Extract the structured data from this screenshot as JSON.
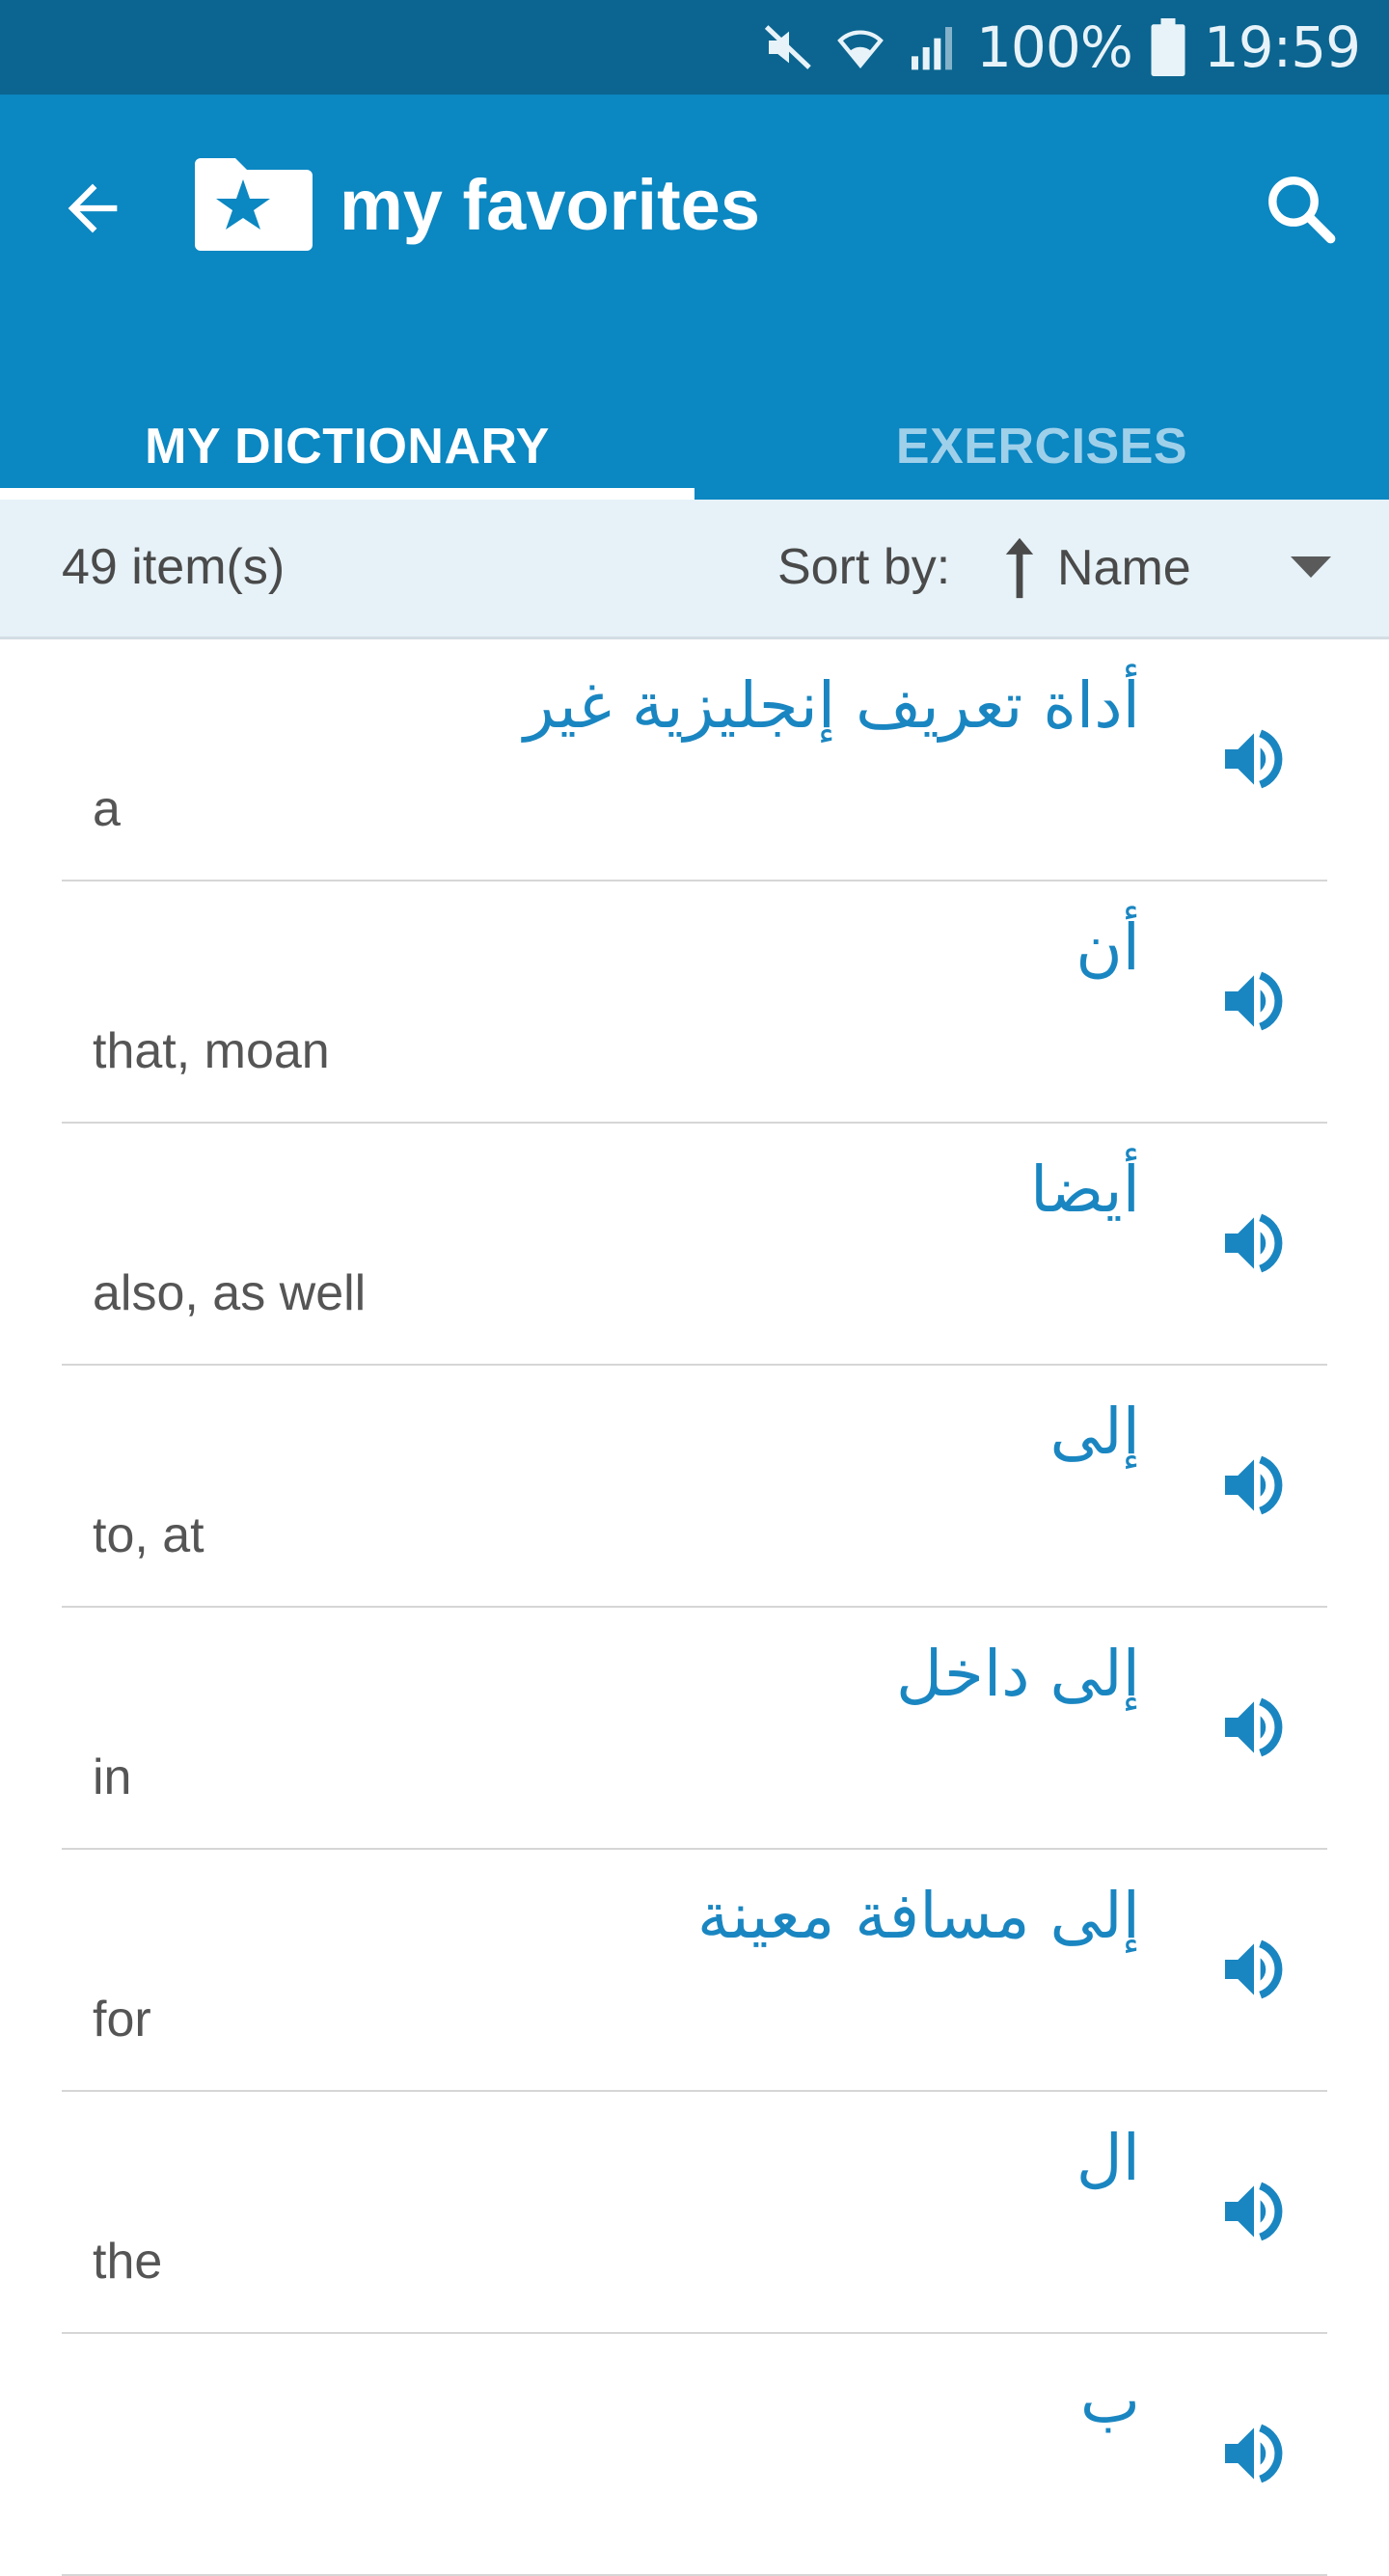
{
  "status_bar": {
    "battery": "100%",
    "time": "19:59",
    "icons": [
      "mute-icon",
      "wifi-icon",
      "signal-icon",
      "battery-icon"
    ]
  },
  "app_bar": {
    "title": "my favorites",
    "icons": [
      "back-arrow-icon",
      "star-folder-icon",
      "search-icon"
    ]
  },
  "tabs": [
    {
      "label": "MY DICTIONARY",
      "active": true
    },
    {
      "label": "EXERCISES",
      "active": false
    }
  ],
  "sort_bar": {
    "count": "49 item(s)",
    "sort_label": "Sort by:",
    "sort_value": "Name"
  },
  "entries": [
    {
      "arabic": "أداة تعريف إنجليزية غير",
      "english": "a"
    },
    {
      "arabic": "أن",
      "english": "that, moan"
    },
    {
      "arabic": "أيضا",
      "english": "also, as well"
    },
    {
      "arabic": "إلى",
      "english": "to, at"
    },
    {
      "arabic": "إلى داخل",
      "english": "in"
    },
    {
      "arabic": "إلى مسافة معينة",
      "english": "for"
    },
    {
      "arabic": "ال",
      "english": "the"
    },
    {
      "arabic": "ب",
      "english": ""
    }
  ],
  "colors": {
    "status_bar": "#0b6590",
    "app_bar": "#0b87c2",
    "accent": "#1a86c1",
    "sort_bar": "#e6f2f8"
  }
}
